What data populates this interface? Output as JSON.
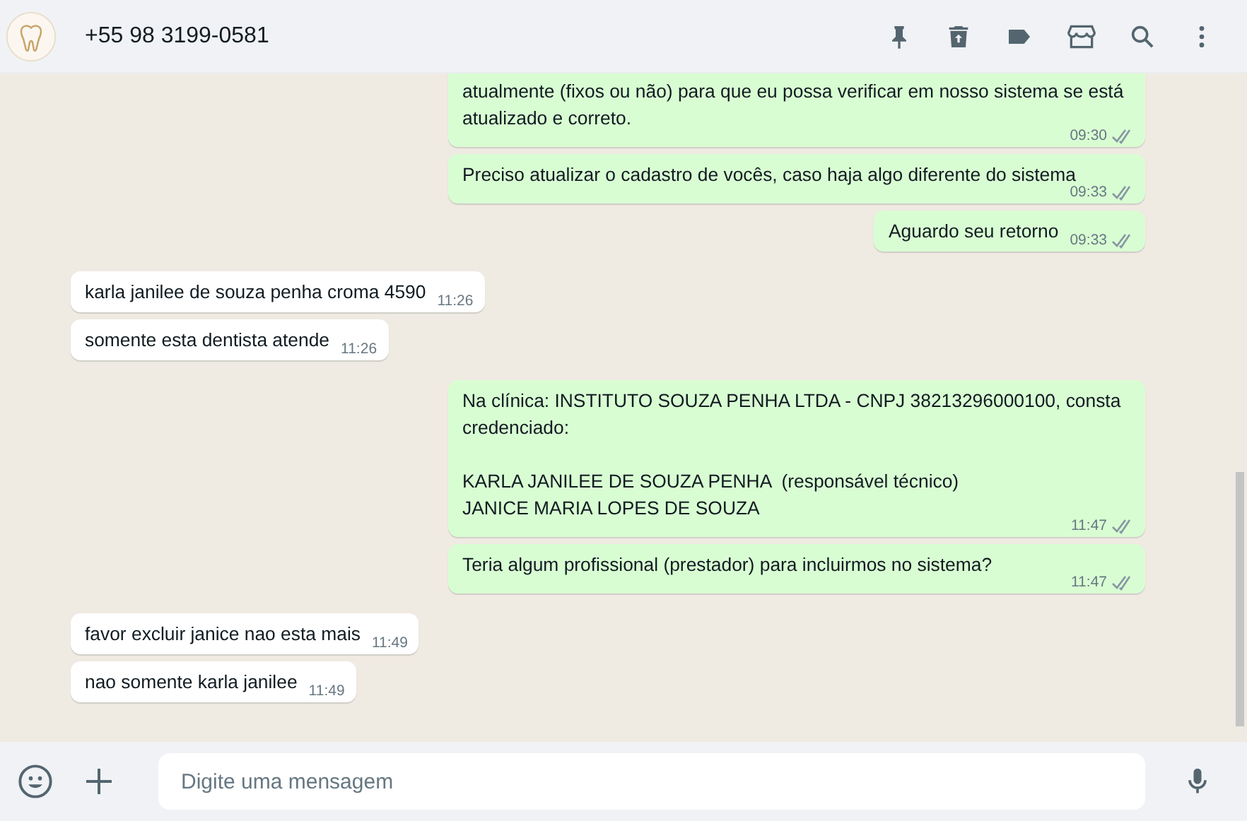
{
  "header": {
    "contact": "+55 98 3199-0581"
  },
  "messages": [
    {
      "kind": "outgoing",
      "text": "atualmente (fixos ou não) para que eu possa verificar em nosso sistema se está atualizado e correto.",
      "time": "09:30",
      "cut_top": true
    },
    {
      "kind": "outgoing",
      "text": "Preciso atualizar o cadastro de vocês, caso haja algo diferente do sistema",
      "time": "09:33",
      "cut_top": false
    },
    {
      "kind": "outgoing",
      "text": "Aguardo seu retorno",
      "time": "09:33",
      "cut_top": false
    },
    {
      "kind": "incoming",
      "text": "karla janilee de souza penha croma 4590",
      "time": "11:26",
      "cut_top": false
    },
    {
      "kind": "incoming",
      "text": "somente esta dentista atende",
      "time": "11:26",
      "cut_top": false
    },
    {
      "kind": "outgoing",
      "text": "Na clínica: INSTITUTO SOUZA PENHA LTDA - CNPJ 38213296000100, consta credenciado:\n\nKARLA JANILEE DE SOUZA PENHA  (responsável técnico)\nJANICE MARIA LOPES DE SOUZA",
      "time": "11:47",
      "cut_top": false
    },
    {
      "kind": "outgoing",
      "text": "Teria algum profissional (prestador) para incluirmos no sistema?",
      "time": "11:47",
      "cut_top": false
    },
    {
      "kind": "incoming",
      "text": "favor excluir janice nao esta mais",
      "time": "11:49",
      "cut_top": false
    },
    {
      "kind": "incoming",
      "text": "nao somente karla janilee",
      "time": "11:49",
      "cut_top": false
    }
  ],
  "composer": {
    "placeholder": "Digite uma mensagem"
  }
}
